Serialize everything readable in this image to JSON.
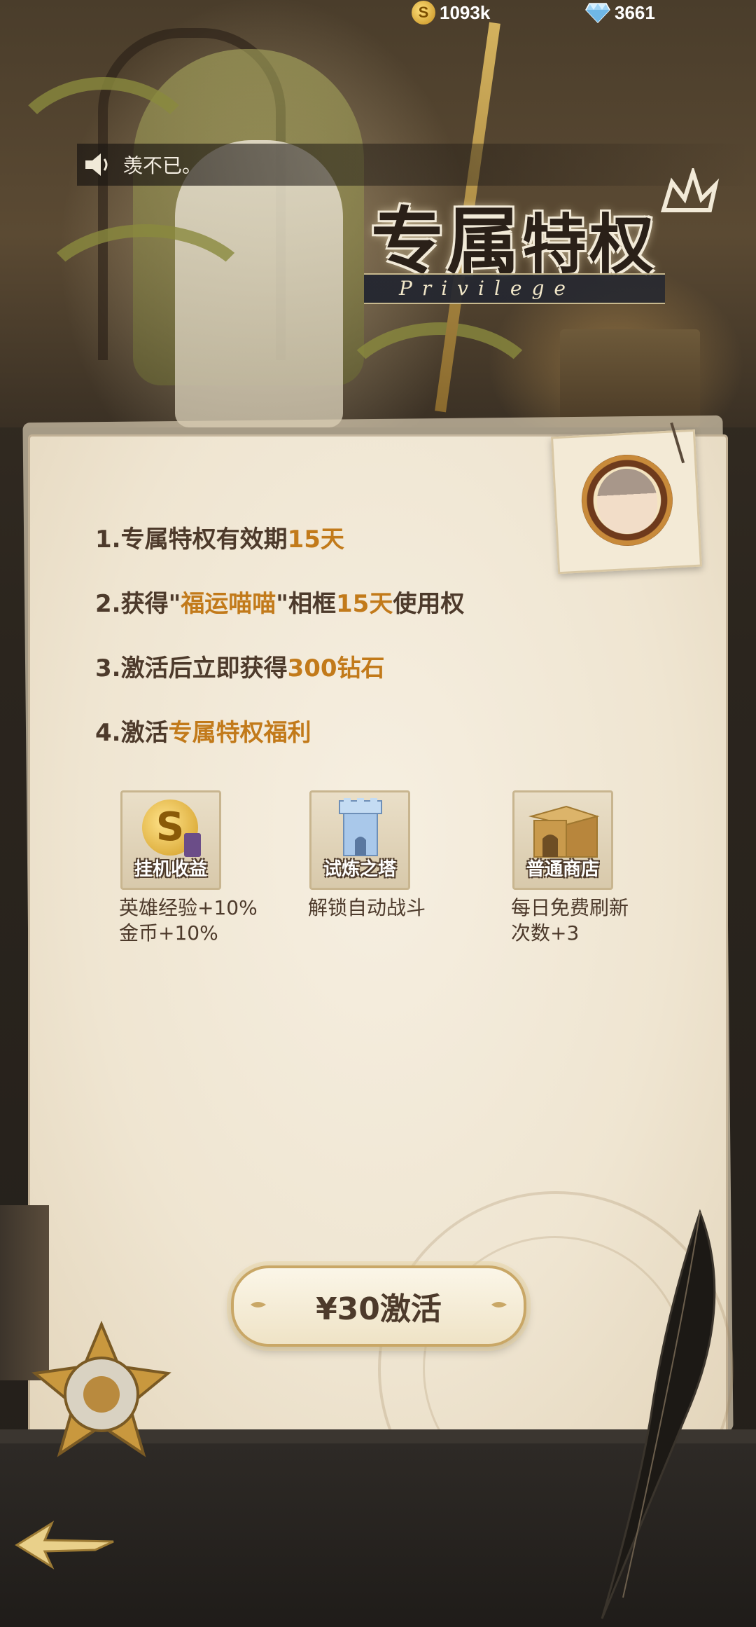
{
  "currency": {
    "gold_icon": "gold-coin-icon",
    "gold_symbol": "S",
    "gold": "1093k",
    "diamond_icon": "diamond-icon",
    "diamonds": "3661"
  },
  "chat": {
    "message": "羡不已。"
  },
  "header": {
    "title_part1": "专属",
    "title_part2": "特权",
    "subtitle": "Privilege"
  },
  "benefits": [
    {
      "prefix": "1.专属特权有效期",
      "highlight": "15天",
      "suffix": ""
    },
    {
      "prefix": "2.获得\"",
      "highlight": "福运喵喵",
      "middle": "\"相框",
      "highlight2": "15天",
      "suffix": "使用权"
    },
    {
      "prefix": "3.激活后立即获得",
      "highlight": "300钻石",
      "suffix": ""
    },
    {
      "prefix": "4.激活",
      "highlight": "专属特权福利",
      "suffix": ""
    }
  ],
  "features": [
    {
      "icon": "idle-income-coin-icon",
      "icon_symbol": "S",
      "label": "挂机收益",
      "desc_line1": "英雄经验+10%",
      "desc_line2": "金币+10%"
    },
    {
      "icon": "trial-tower-icon",
      "label": "试炼之塔",
      "desc_line1": "解锁自动战斗",
      "desc_line2": ""
    },
    {
      "icon": "shop-stall-icon",
      "label": "普通商店",
      "desc_line1": "每日免费刷新",
      "desc_line2": "次数+3"
    }
  ],
  "activate": {
    "label": "¥30激活"
  },
  "colors": {
    "highlight": "#c27a1a",
    "text": "#4d3a2b",
    "parchment": "#efe5d1"
  }
}
